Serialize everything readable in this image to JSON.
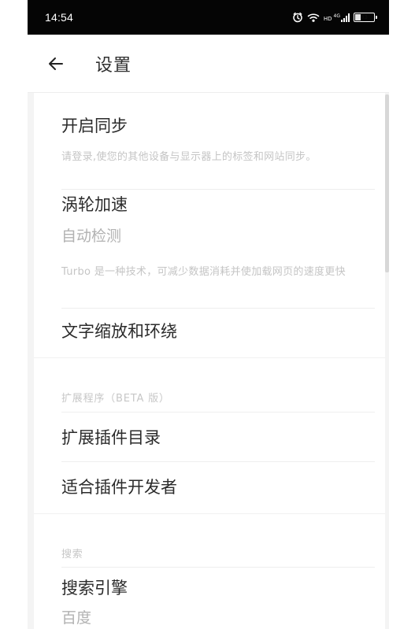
{
  "status_bar": {
    "time": "14:54",
    "network_label": "4G",
    "hd_label": "HD",
    "battery_label": "33",
    "battery_level": 0.33,
    "icons": [
      "alarm-icon",
      "wifi-icon",
      "signal-icon",
      "battery-icon"
    ]
  },
  "app_bar": {
    "title": "设置",
    "back_icon": "arrow-left-icon"
  },
  "settings": {
    "sync": {
      "title": "开启同步",
      "description": "请登录,使您的其他设备与显示器上的标签和网站同步。"
    },
    "turbo": {
      "title": "涡轮加速",
      "value": "自动检测",
      "description": "Turbo 是一种技术，可减少数据消耗并使加载网页的速度更快"
    },
    "text_scaling": {
      "title": "文字缩放和环绕"
    },
    "extensions": {
      "header": "扩展程序（BETA 版）",
      "catalog": "扩展插件目录",
      "developer": "适合插件开发者"
    },
    "search": {
      "header": "搜索",
      "engine_title": "搜索引擎",
      "engine_value": "百度"
    }
  },
  "colors": {
    "status_background": "#050505",
    "page_background": "#ffffff",
    "primary_text": "#2b2b2b",
    "secondary_text": "#b2b2b2",
    "muted_text": "#c5c5c5"
  }
}
